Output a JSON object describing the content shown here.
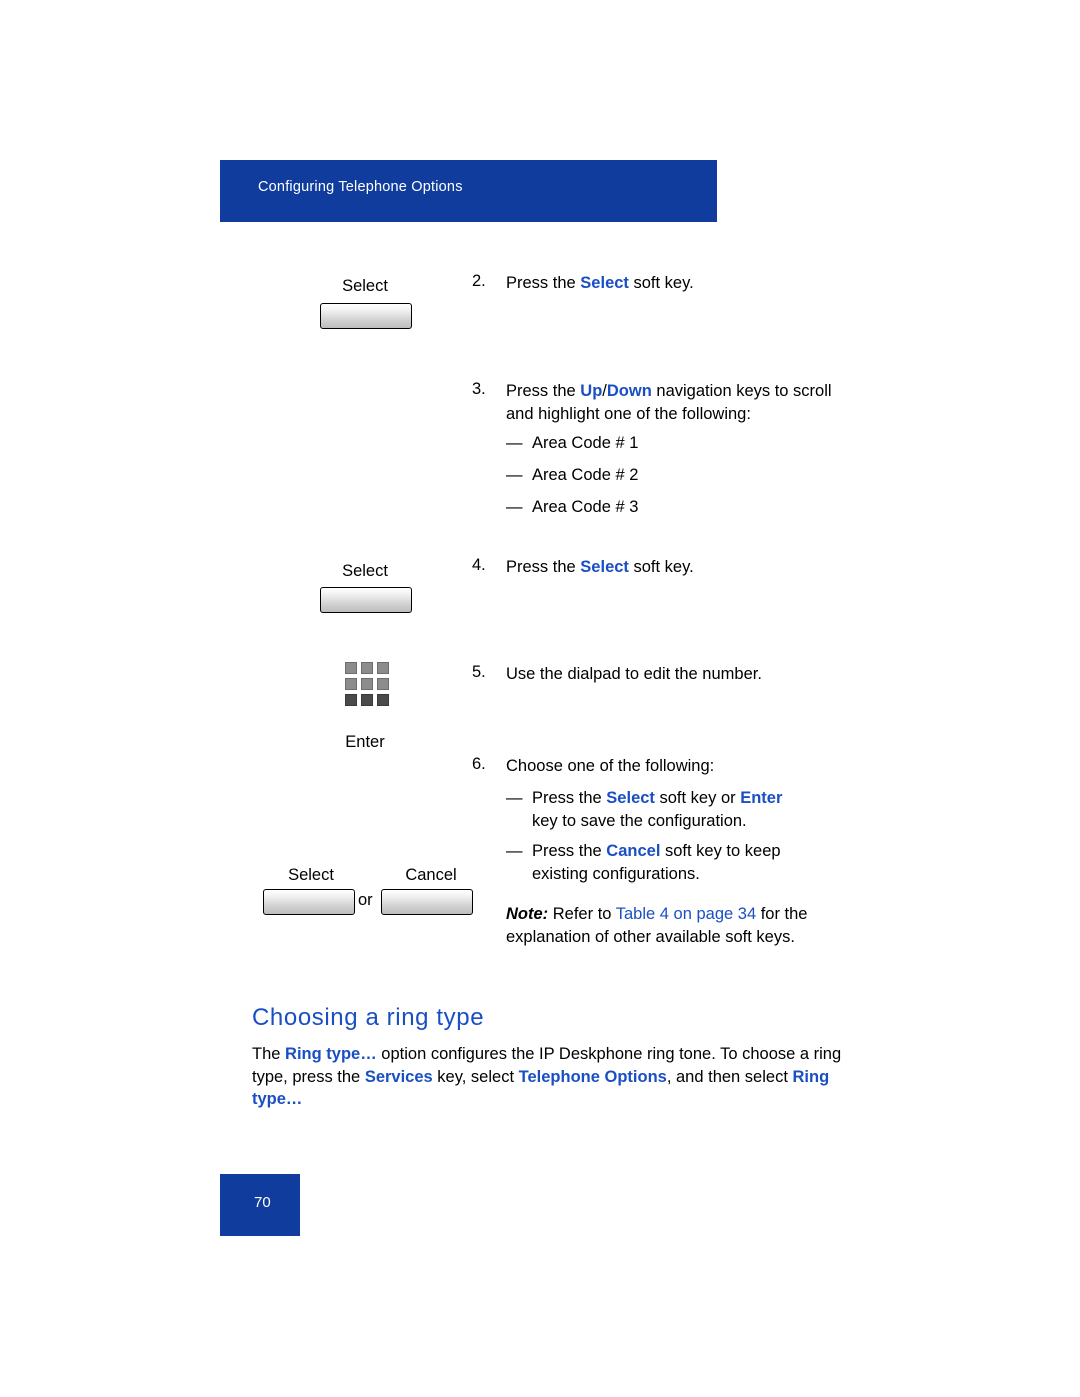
{
  "header": {
    "title": "Configuring Telephone Options"
  },
  "steps": [
    {
      "number": "2.",
      "parts": [
        {
          "text": "Press the ",
          "style": "plain"
        },
        {
          "text": "Select",
          "style": "bold-blue"
        },
        {
          "text": " soft key.",
          "style": "plain"
        }
      ],
      "key_label": "Select"
    },
    {
      "number": "3.",
      "parts": [
        {
          "text": "Press the ",
          "style": "plain"
        },
        {
          "text": "Up",
          "style": "bold-blue"
        },
        {
          "text": "/",
          "style": "plain"
        },
        {
          "text": "Down",
          "style": "bold-blue"
        },
        {
          "text": " navigation keys to scroll and highlight one of the following:",
          "style": "plain"
        }
      ],
      "bullets": [
        "Area Code # 1",
        "Area Code # 2",
        "Area Code # 3"
      ]
    },
    {
      "number": "4.",
      "parts": [
        {
          "text": "Press the ",
          "style": "plain"
        },
        {
          "text": "Select",
          "style": "bold-blue"
        },
        {
          "text": " soft key.",
          "style": "plain"
        }
      ],
      "key_label": "Select"
    },
    {
      "number": "5.",
      "parts": [
        {
          "text": "Use the dialpad to edit the number.",
          "style": "plain"
        }
      ]
    },
    {
      "number": "6.",
      "parts": [
        {
          "text": "Choose one of the following:",
          "style": "plain"
        }
      ]
    }
  ],
  "labels": {
    "enter_key": "Enter",
    "select_key": "Select",
    "cancel_key": "Cancel",
    "or": "or"
  },
  "bullet6": {
    "line1_a": "Press the ",
    "line1_select": "Select",
    "line1_b": " soft key or ",
    "line1_enter": "Enter",
    "line2": "key to save the configuration.",
    "line3_a": "Press the ",
    "line3_cancel": "Cancel",
    "line3_b": " soft key to keep",
    "line4": "existing configurations."
  },
  "note": {
    "label": "Note:",
    "text_a": " Refer to ",
    "link": " Table 4 on page 34",
    "text_b": " for the explanation of other available soft keys."
  },
  "section": {
    "heading": "Choosing a ring type",
    "para_1": "The ",
    "para_ringtype1": "Ring type…",
    "para_2": " option configures the IP Deskphone ring tone. To choose a ring type, press the ",
    "para_services": "Services",
    "para_3": " key, select ",
    "para_telopts": "Telephone Options",
    "para_4": ", and then select ",
    "para_ringtype2": "Ring type…"
  },
  "footer": {
    "page_number": "70"
  },
  "colors": {
    "accent_blue": "#103c9e",
    "link_blue": "#1a4fc4"
  }
}
